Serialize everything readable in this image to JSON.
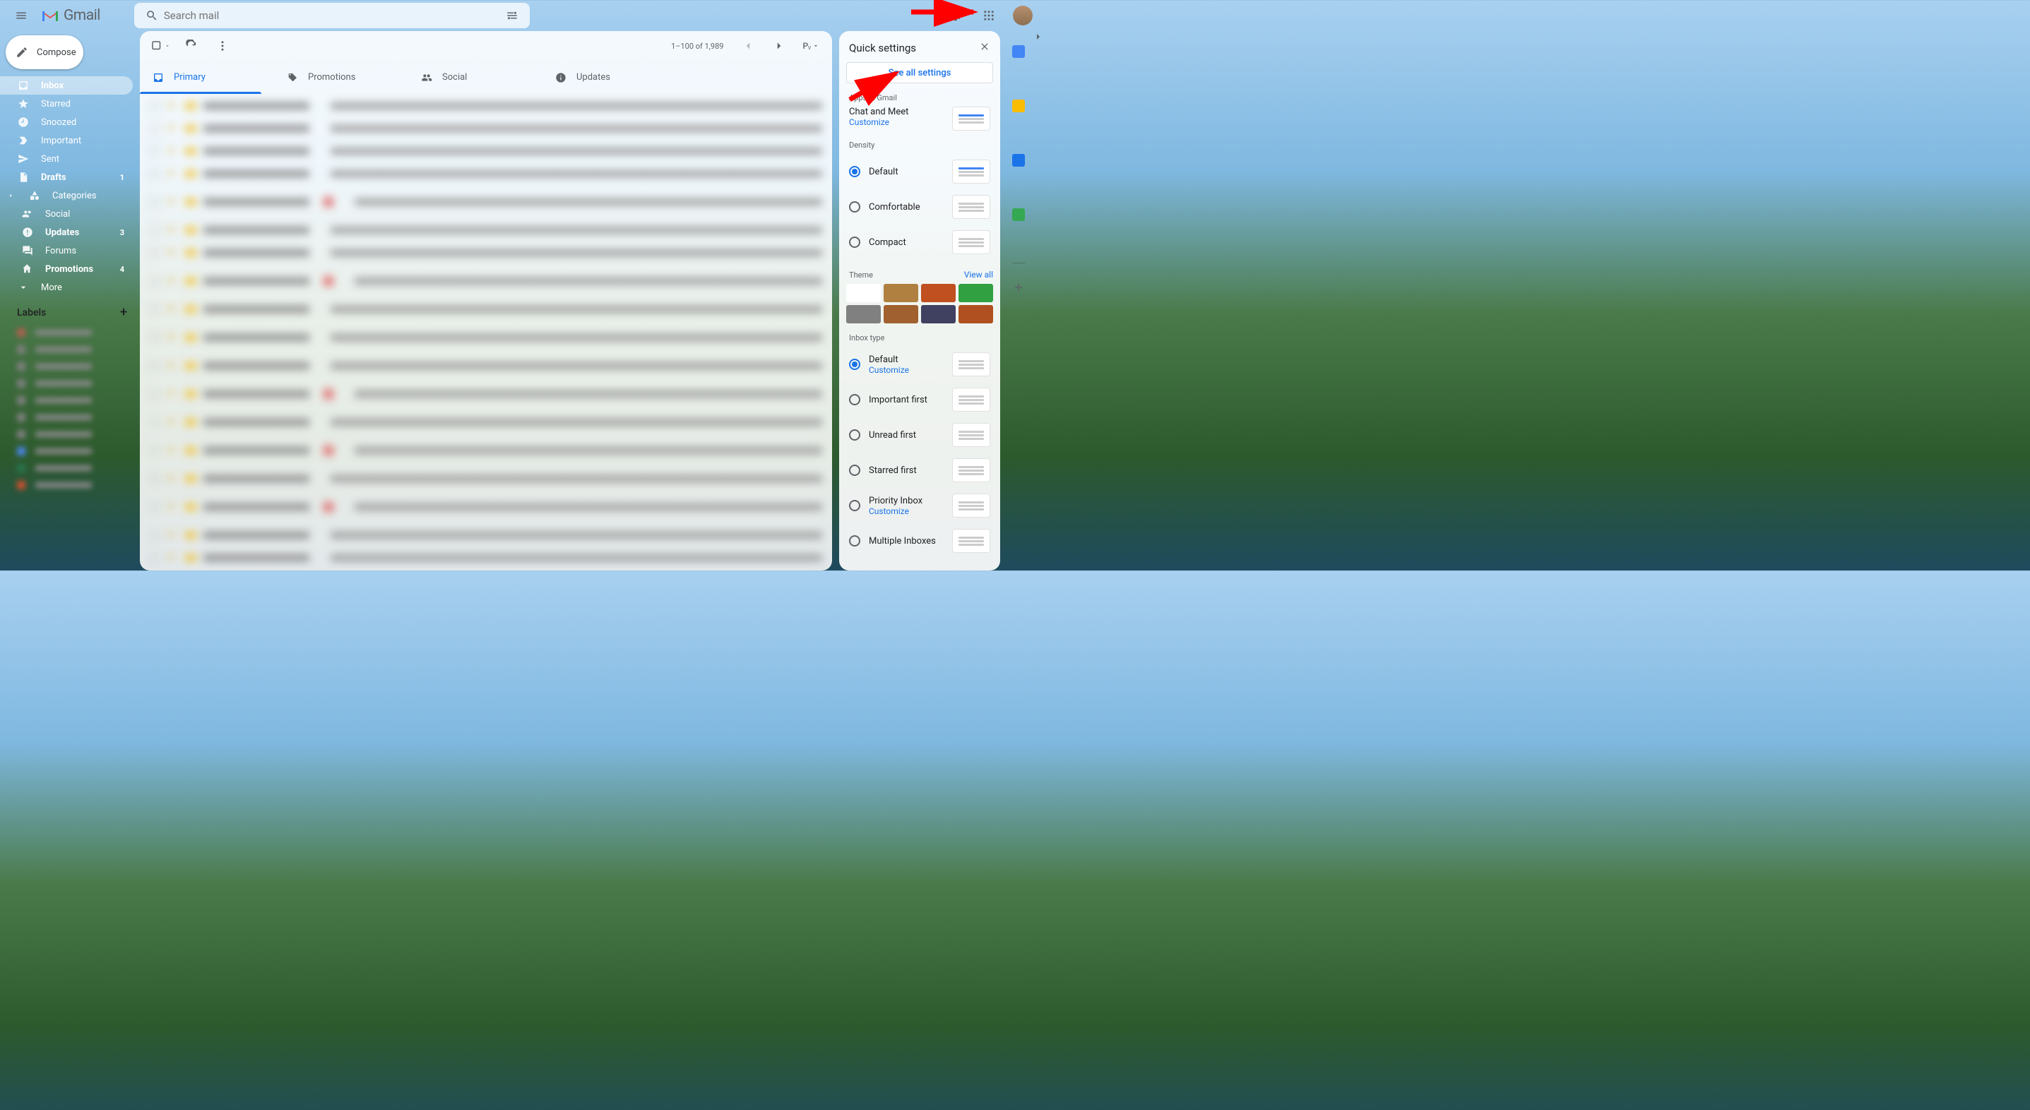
{
  "header": {
    "app_name": "Gmail",
    "search_placeholder": "Search mail"
  },
  "compose_label": "Compose",
  "sidebar": {
    "items": [
      {
        "icon": "inbox",
        "label": "Inbox",
        "count": "",
        "selected": true,
        "bold": true
      },
      {
        "icon": "star",
        "label": "Starred",
        "count": "",
        "bold": false
      },
      {
        "icon": "clock",
        "label": "Snoozed",
        "count": "",
        "bold": false
      },
      {
        "icon": "important",
        "label": "Important",
        "count": "",
        "bold": false
      },
      {
        "icon": "send",
        "label": "Sent",
        "count": "",
        "bold": false
      },
      {
        "icon": "draft",
        "label": "Drafts",
        "count": "1",
        "bold": true
      },
      {
        "icon": "category",
        "label": "Categories",
        "count": "",
        "bold": false
      },
      {
        "icon": "social",
        "label": "Social",
        "count": "",
        "bold": false,
        "indent": true
      },
      {
        "icon": "updates",
        "label": "Updates",
        "count": "3",
        "bold": true,
        "indent": true
      },
      {
        "icon": "forums",
        "label": "Forums",
        "count": "",
        "bold": false,
        "indent": true
      },
      {
        "icon": "promotions",
        "label": "Promotions",
        "count": "4",
        "bold": true,
        "indent": true
      },
      {
        "icon": "more",
        "label": "More",
        "count": "",
        "bold": false
      }
    ],
    "labels_header": "Labels",
    "label_colors": [
      "#b06050",
      "#808080",
      "#808080",
      "#808080",
      "#808080",
      "#808080",
      "#808080",
      "#4a86e8",
      "#28754e",
      "#d05030"
    ]
  },
  "toolbar": {
    "pagination": "1–100 of 1,989",
    "split_label": "Pᵥ"
  },
  "tabs": [
    {
      "icon": "inbox",
      "label": "Primary",
      "active": true
    },
    {
      "icon": "tag",
      "label": "Promotions",
      "active": false
    },
    {
      "icon": "people",
      "label": "Social",
      "active": false
    },
    {
      "icon": "info",
      "label": "Updates",
      "active": false
    }
  ],
  "quick_settings": {
    "title": "Quick settings",
    "see_all": "See all settings",
    "apps_section": "Apps in Gmail",
    "chat_meet": "Chat and Meet",
    "customize": "Customize",
    "density_section": "Density",
    "density_options": [
      "Default",
      "Comfortable",
      "Compact"
    ],
    "theme_section": "Theme",
    "view_all": "View all",
    "theme_swatches": [
      "#ffffff",
      "#b08040",
      "#c05020",
      "#30a040",
      "#808080",
      "#a06030",
      "#404060",
      "#b05020"
    ],
    "inbox_type_section": "Inbox type",
    "inbox_options": [
      {
        "label": "Default",
        "sublink": "Customize"
      },
      {
        "label": "Important first",
        "sublink": ""
      },
      {
        "label": "Unread first",
        "sublink": ""
      },
      {
        "label": "Starred first",
        "sublink": ""
      },
      {
        "label": "Priority Inbox",
        "sublink": "Customize"
      },
      {
        "label": "Multiple Inboxes",
        "sublink": ""
      }
    ]
  },
  "right_apps": [
    {
      "name": "calendar",
      "color": "#4285f4"
    },
    {
      "name": "keep",
      "color": "#fbbc04"
    },
    {
      "name": "tasks",
      "color": "#1a73e8"
    },
    {
      "name": "contacts",
      "color": "#34a853"
    }
  ]
}
